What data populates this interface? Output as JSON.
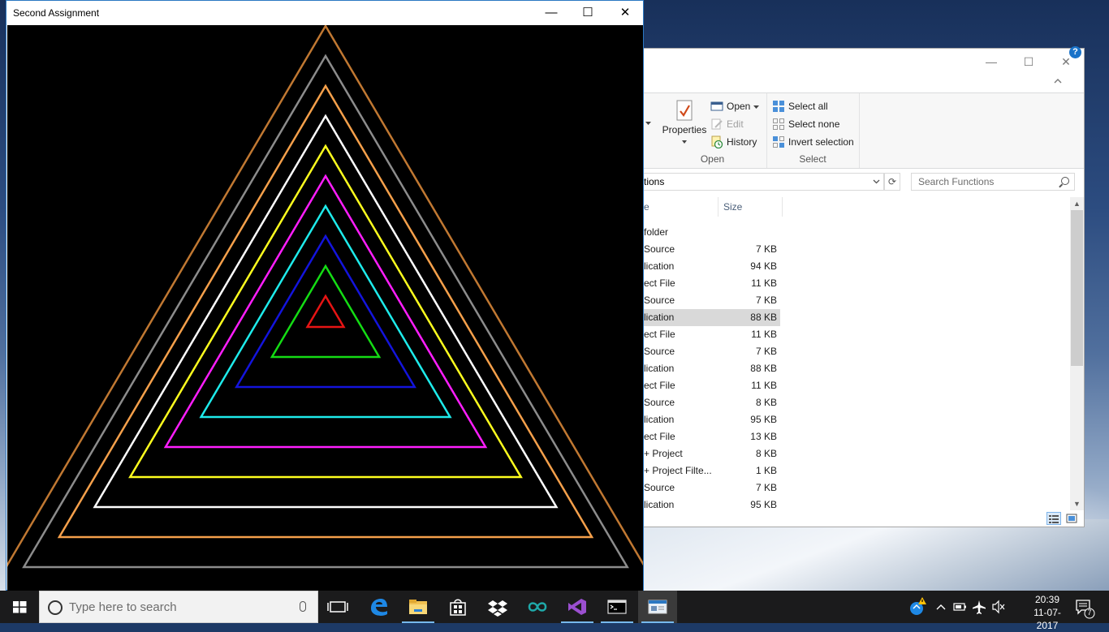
{
  "app_window": {
    "title": "Second Assignment",
    "controls": {
      "minimize": "—",
      "maximize": "☐",
      "close": "✕"
    },
    "triangle_colors": [
      "#c07832",
      "#8c8c8c",
      "#f5a04b",
      "#ffffff",
      "#ffff1e",
      "#ff1eff",
      "#1eebeb",
      "#1414dc",
      "#14dc14",
      "#e61414"
    ]
  },
  "explorer": {
    "controls": {
      "minimize": "—",
      "maximize": "☐",
      "close": "✕"
    },
    "ribbon": {
      "open_group": {
        "properties_label": "Properties",
        "open_label": "Open",
        "edit_label": "Edit",
        "history_label": "History",
        "group_label": "Open"
      },
      "select_group": {
        "select_all_label": "Select all",
        "select_none_label": "Select none",
        "invert_label": "Invert selection",
        "group_label": "Select"
      }
    },
    "address_text": "tions",
    "search_placeholder": "Search Functions",
    "columns": {
      "name": "e",
      "size": "Size"
    },
    "group_label": "folder",
    "files": [
      {
        "type": " Source",
        "size": "7 KB"
      },
      {
        "type": "lication",
        "size": "94 KB"
      },
      {
        "type": "ect File",
        "size": "11 KB"
      },
      {
        "type": " Source",
        "size": "7 KB"
      },
      {
        "type": "lication",
        "size": "88 KB",
        "selected": true
      },
      {
        "type": "ect File",
        "size": "11 KB"
      },
      {
        "type": " Source",
        "size": "7 KB"
      },
      {
        "type": "lication",
        "size": "88 KB"
      },
      {
        "type": "ect File",
        "size": "11 KB"
      },
      {
        "type": " Source",
        "size": "8 KB"
      },
      {
        "type": "lication",
        "size": "95 KB"
      },
      {
        "type": "ect File",
        "size": "13 KB"
      },
      {
        "type": "+ Project",
        "size": "8 KB"
      },
      {
        "type": "+ Project Filte...",
        "size": "1 KB"
      },
      {
        "type": " Source",
        "size": "7 KB"
      },
      {
        "type": "lication",
        "size": "95 KB"
      }
    ]
  },
  "taskbar": {
    "search_placeholder": "Type here to search",
    "time": "20:39",
    "date": "11-07-2017",
    "notification_count": "7",
    "colors": {
      "accent": "#76b9ed"
    }
  }
}
